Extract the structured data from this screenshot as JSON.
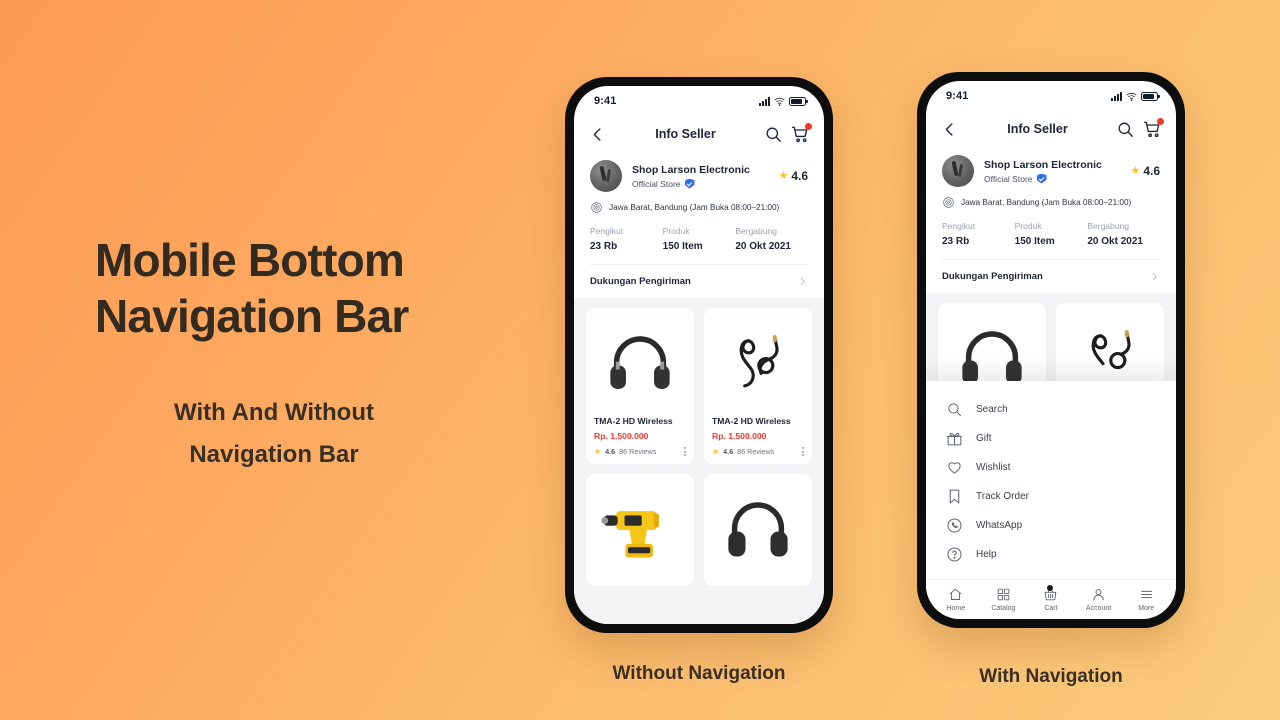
{
  "background": {
    "from": "#fd9a52",
    "to": "#fbcb7c"
  },
  "promo": {
    "title_line1": "Mobile Bottom",
    "title_line2": "Navigation Bar",
    "subtitle_line1": "With And Without",
    "subtitle_line2": "Navigation Bar"
  },
  "captions": {
    "left": "Without Navigation",
    "right": "With Navigation"
  },
  "statusbar": {
    "time": "9:41"
  },
  "appbar": {
    "title": "Info Seller",
    "back_icon": "chevron-left-icon",
    "search_icon": "search-icon",
    "cart_icon": "cart-icon",
    "badge_color": "#f6352c"
  },
  "seller": {
    "name": "Shop Larson Electronic",
    "badge_label": "Official Store",
    "rating": "4.6",
    "location": "Jawa Barat, Bandung (Jam Buka 08:00–21:00)",
    "stats": [
      {
        "label": "Pengikut",
        "value": "23 Rb"
      },
      {
        "label": "Produk",
        "value": "150 Item"
      },
      {
        "label": "Bergabung",
        "value": "20 Okt 2021"
      }
    ],
    "shipping_row": "Dukungan Pengiriman"
  },
  "products": [
    {
      "title": "TMA-2 HD Wireless",
      "price": "Rp. 1.500.000",
      "rating": "4.6",
      "reviews": "86 Reviews",
      "art": "headphones"
    },
    {
      "title": "TMA-2 HD Wireless",
      "price": "Rp. 1.500.000",
      "rating": "4.6",
      "reviews": "86 Reviews",
      "art": "cable"
    },
    {
      "title": "",
      "price": "",
      "rating": "",
      "reviews": "",
      "art": "drill"
    },
    {
      "title": "",
      "price": "",
      "rating": "",
      "reviews": "",
      "art": "headphones2"
    }
  ],
  "menu": {
    "items": [
      {
        "label": "Search",
        "icon": "search-icon"
      },
      {
        "label": "Gift",
        "icon": "gift-icon"
      },
      {
        "label": "Wishlist",
        "icon": "heart-icon"
      },
      {
        "label": "Track Order",
        "icon": "bookmark-icon"
      },
      {
        "label": "WhatsApp",
        "icon": "whatsapp-icon"
      },
      {
        "label": "Help",
        "icon": "question-circle-icon"
      }
    ]
  },
  "bottom_nav": {
    "items": [
      {
        "label": "Home",
        "icon": "home-icon",
        "badge": false
      },
      {
        "label": "Catalog",
        "icon": "grid-icon",
        "badge": false
      },
      {
        "label": "Cart",
        "icon": "basket-icon",
        "badge": true
      },
      {
        "label": "Account",
        "icon": "person-icon",
        "badge": false
      },
      {
        "label": "More",
        "icon": "hamburger-icon",
        "badge": false
      }
    ]
  }
}
